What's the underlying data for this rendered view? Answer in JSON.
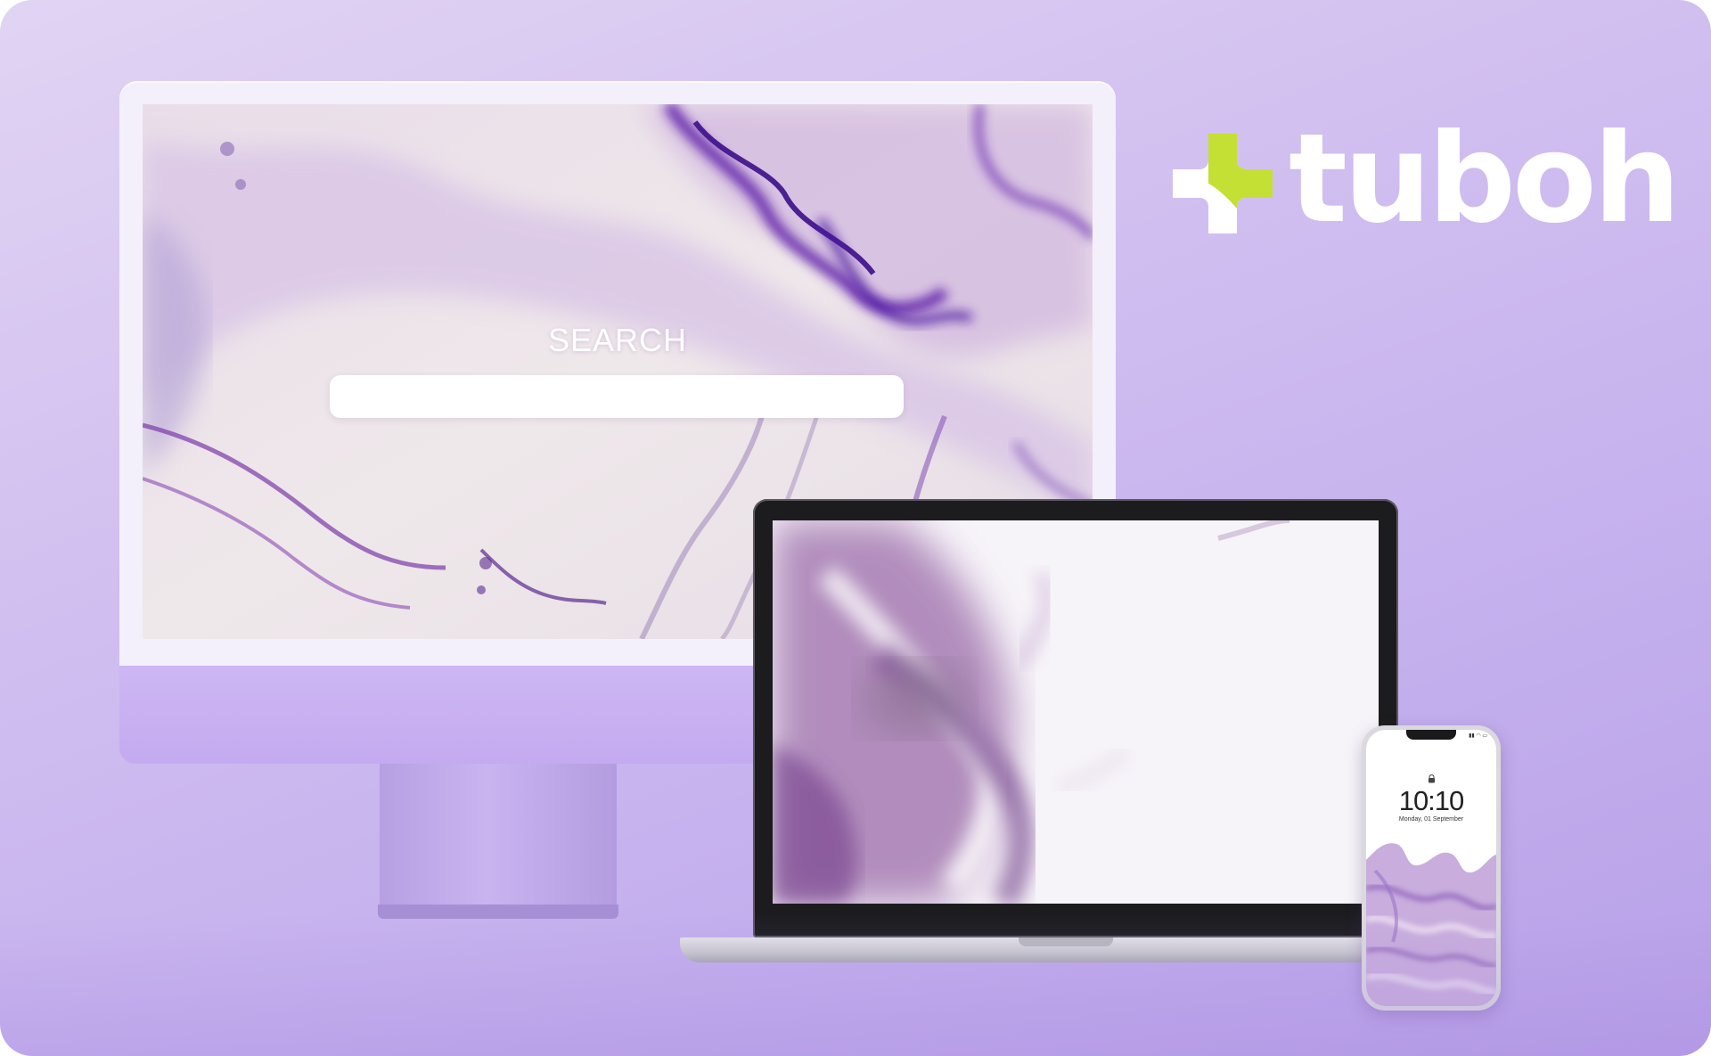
{
  "brand": {
    "name": "tuboh",
    "mark_color": "#c4e034",
    "text_color": "#ffffff"
  },
  "desktop": {
    "search_title": "SEARCH",
    "search_value": "",
    "frame_color": "#f4f0fb",
    "chin_color": "#cdb7f3"
  },
  "laptop": {
    "bezel_color": "#1c1c1f"
  },
  "phone": {
    "time": "10:10",
    "date": "Monday, 01 September",
    "icons": [
      "lock-icon",
      "signal-icon",
      "wifi-icon",
      "battery-icon"
    ]
  },
  "colors": {
    "background_top": "#e1d4f3",
    "background_bottom": "#b8a0e8",
    "marble_purple": "#5b1fa8"
  }
}
